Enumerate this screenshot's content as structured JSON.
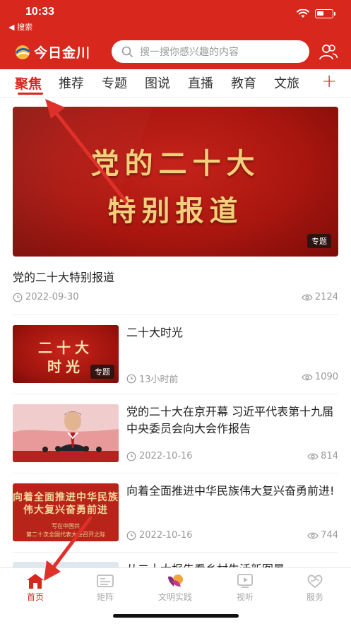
{
  "status_bar": {
    "time": "10:33",
    "back_label": "◀ 搜索"
  },
  "header": {
    "app_name": "今日金川",
    "search_placeholder": "搜一搜你感兴趣的内容",
    "brand_color": "#d8271c"
  },
  "tabs": [
    {
      "label": "聚焦",
      "active": true
    },
    {
      "label": "推荐"
    },
    {
      "label": "专题"
    },
    {
      "label": "图说"
    },
    {
      "label": "直播"
    },
    {
      "label": "教育"
    },
    {
      "label": "文旅"
    }
  ],
  "tab_add_label": "+",
  "hero": {
    "image_text_line1": "党的二十大",
    "image_text_line2": "特别报道",
    "badge": "专题",
    "title": "党的二十大特别报道",
    "date": "2022-09-30",
    "views": "2124"
  },
  "items": [
    {
      "title": "二十大时光",
      "thumb_line1": "二十大",
      "thumb_line2": "时光",
      "badge": "专题",
      "date": "13小时前",
      "views": "1090"
    },
    {
      "title": "党的二十大在京开幕 习近平代表第十九届中央委员会向大会作报告",
      "date": "2022-10-16",
      "views": "814"
    },
    {
      "title": "向着全面推进中华民族伟大复兴奋勇前进!",
      "thumb_line1": "向着全面推进中华民族",
      "thumb_line2": "伟大复兴奋勇前进",
      "thumb_small1": "写在中国共",
      "thumb_small2": "第二十次全国代表大会召开之际",
      "date": "2022-10-16",
      "views": "744"
    }
  ],
  "peek_title": "从二十大报告看乡村生活新图景",
  "bottom_nav": [
    {
      "label": "首页",
      "icon": "home-icon",
      "active": true
    },
    {
      "label": "矩阵",
      "icon": "matrix-icon"
    },
    {
      "label": "文明实践",
      "icon": "civilization-icon"
    },
    {
      "label": "视听",
      "icon": "video-icon"
    },
    {
      "label": "服务",
      "icon": "service-icon"
    }
  ]
}
